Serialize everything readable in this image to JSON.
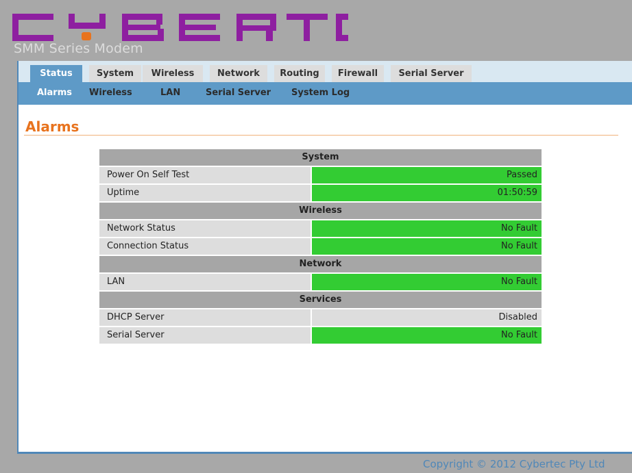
{
  "header": {
    "logo_text": "CYBERTEC",
    "logo_color": "#8e1fa0",
    "logo_dot_color": "#e8731e",
    "subtitle": "SMM Series Modem"
  },
  "tabs": [
    {
      "label": "Status",
      "active": true
    },
    {
      "label": "System",
      "active": false
    },
    {
      "label": "Wireless",
      "active": false
    },
    {
      "label": "Network",
      "active": false
    },
    {
      "label": "Routing",
      "active": false
    },
    {
      "label": "Firewall",
      "active": false
    },
    {
      "label": "Serial Server",
      "active": false
    }
  ],
  "subnav": [
    {
      "label": "Alarms",
      "active": true
    },
    {
      "label": "Wireless",
      "active": false
    },
    {
      "label": "LAN",
      "active": false
    },
    {
      "label": "Serial Server",
      "active": false
    },
    {
      "label": "System Log",
      "active": false
    }
  ],
  "page": {
    "title": "Alarms"
  },
  "alarms": {
    "system": {
      "header": "System",
      "rows": [
        {
          "label": "Power On Self Test",
          "value": "Passed",
          "status": "ok"
        },
        {
          "label": "Uptime",
          "value": "01:50:59",
          "status": "ok"
        }
      ]
    },
    "wireless": {
      "header": "Wireless",
      "rows": [
        {
          "label": "Network Status",
          "value": "No Fault",
          "status": "ok"
        },
        {
          "label": "Connection Status",
          "value": "No Fault",
          "status": "ok"
        }
      ]
    },
    "network": {
      "header": "Network",
      "rows": [
        {
          "label": "LAN",
          "value": "No Fault",
          "status": "ok"
        }
      ]
    },
    "services": {
      "header": "Services",
      "rows": [
        {
          "label": "DHCP Server",
          "value": "Disabled",
          "status": "neutral"
        },
        {
          "label": "Serial Server",
          "value": "No Fault",
          "status": "ok"
        }
      ]
    }
  },
  "colors": {
    "ok_green": "#33cc33",
    "neutral_gray": "#dddddd",
    "accent_blue": "#5e9ac7",
    "title_orange": "#e8731e"
  },
  "footer": {
    "copyright": "Copyright © 2012 Cybertec Pty Ltd"
  }
}
